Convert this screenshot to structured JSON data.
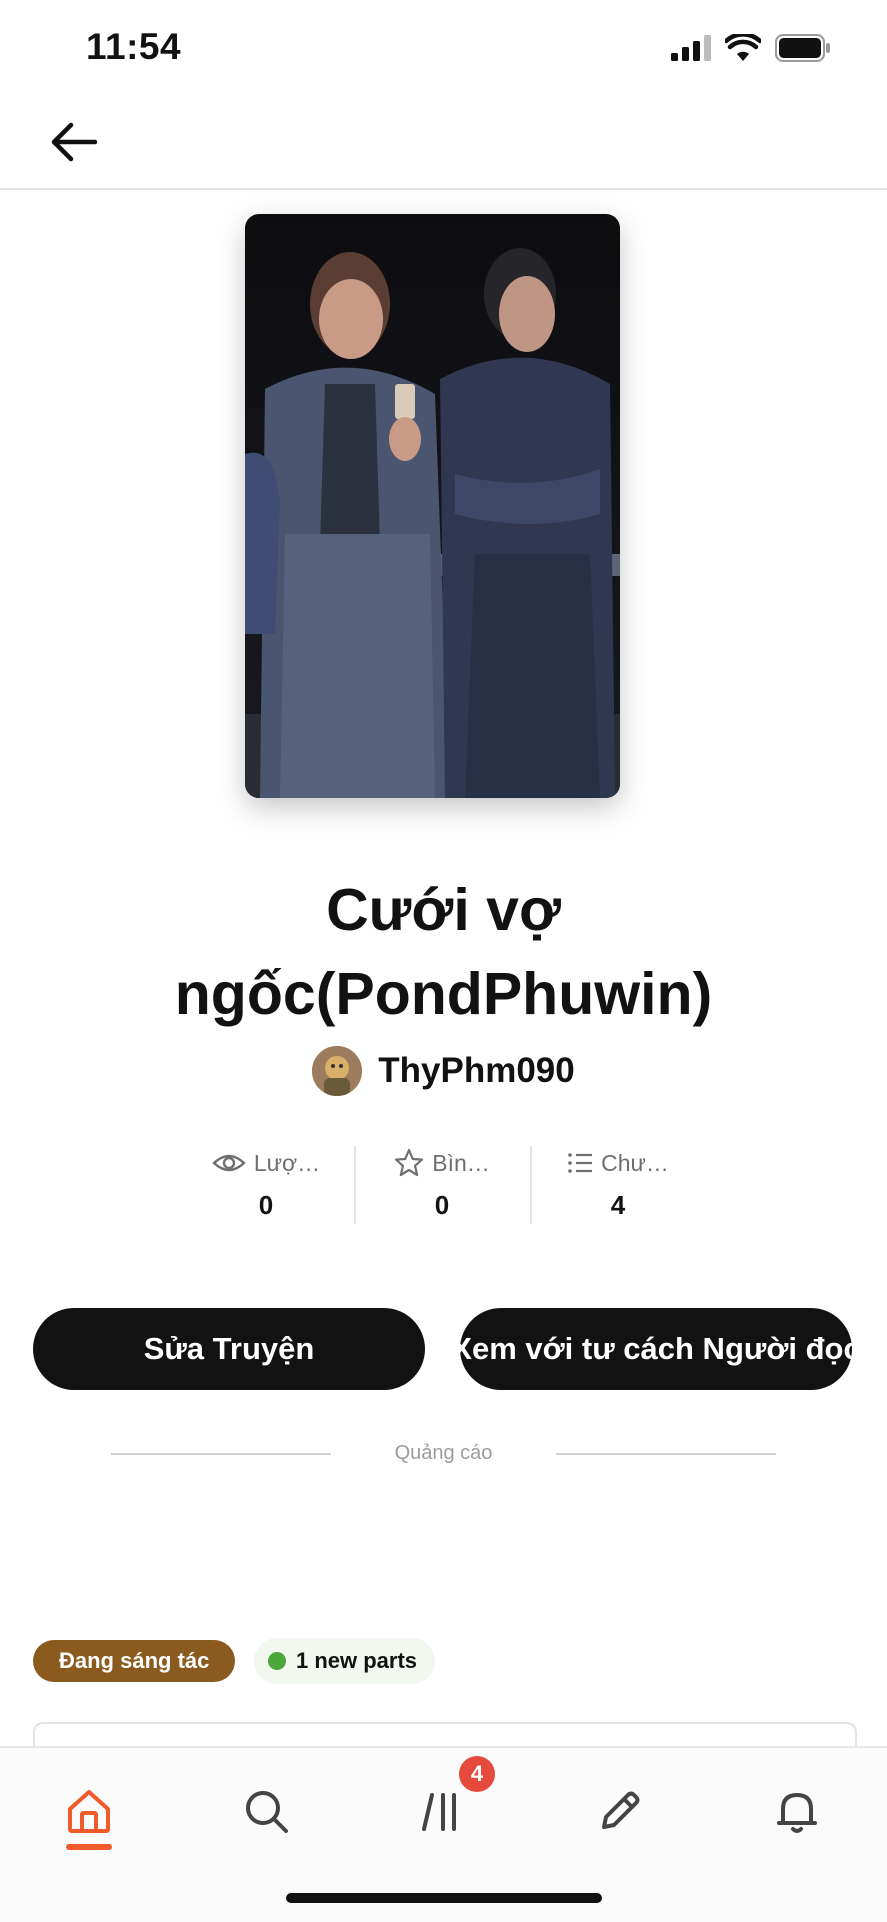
{
  "status_bar": {
    "time": "11:54"
  },
  "story": {
    "title": "Cưới vợ ngốc(PondPhuwin)",
    "author": "ThyPhm090",
    "stats": [
      {
        "icon": "eye-icon",
        "label": "Lượ…",
        "value": "0"
      },
      {
        "icon": "star-icon",
        "label": "Bìn…",
        "value": "0"
      },
      {
        "icon": "list-icon",
        "label": "Chư…",
        "value": "4"
      }
    ]
  },
  "actions": {
    "edit_label": "Sửa Truyện",
    "read_label": "Xem với tư cách Người đọc"
  },
  "ad": {
    "label": "Quảng cáo"
  },
  "tags": {
    "status": "Đang sáng tác",
    "new_parts": "1 new parts"
  },
  "tabbar": {
    "tabs": [
      "home-icon",
      "search-icon",
      "library-icon",
      "pencil-icon",
      "bell-icon"
    ],
    "library_badge": "4",
    "active_color": "#f05b2b"
  }
}
